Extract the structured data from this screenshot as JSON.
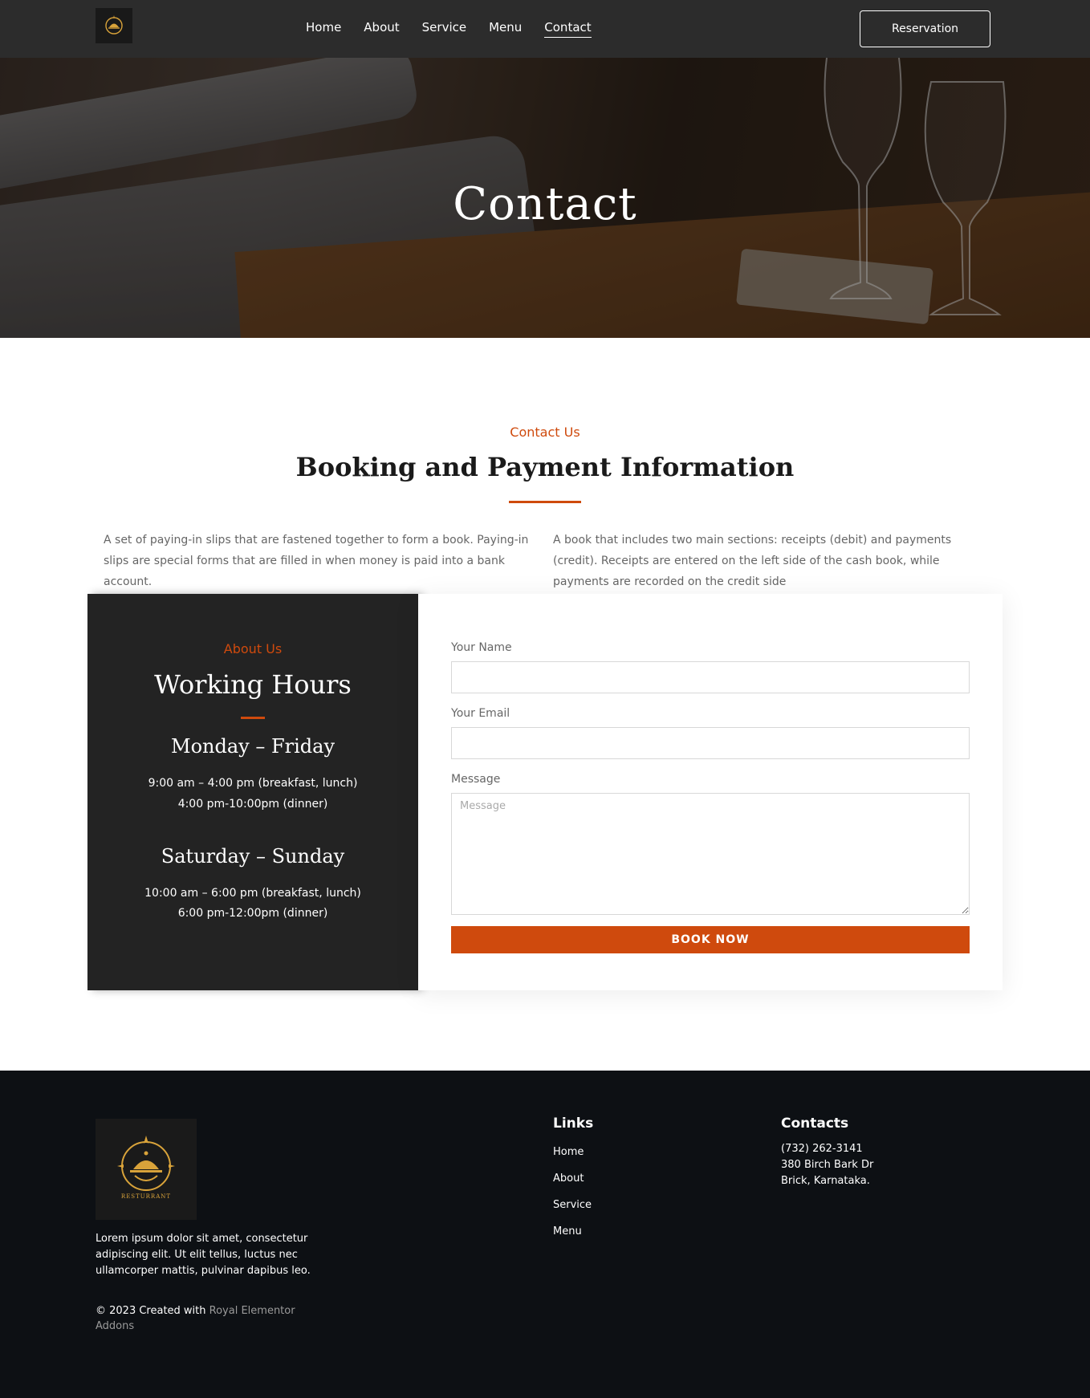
{
  "header": {
    "nav": [
      "Home",
      "About",
      "Service",
      "Menu",
      "Contact"
    ],
    "active_nav": "Contact",
    "reservation_label": "Reservation"
  },
  "hero": {
    "title": "Contact"
  },
  "booking": {
    "eyebrow": "Contact Us",
    "title": "Booking and Payment Information",
    "left_text": "A set of paying-in slips that are fastened together to form a book. Paying-in slips are special forms that are filled in when money is paid into a bank account.",
    "right_text": "A book that includes two main sections: receipts (debit) and payments (credit). Receipts are entered on the left side of the cash book, while payments are recorded on the credit side"
  },
  "hours": {
    "eyebrow": "About Us",
    "title": "Working Hours",
    "weekday_label": "Monday – Friday",
    "weekday_time_1": "9:00 am – 4:00 pm (breakfast, lunch)",
    "weekday_time_2": "4:00 pm-10:00pm (dinner)",
    "weekend_label": "Saturday – Sunday",
    "weekend_time_1": "10:00 am – 6:00 pm (breakfast, lunch)",
    "weekend_time_2": "6:00 pm-12:00pm (dinner)"
  },
  "form": {
    "name_label": "Your Name",
    "name_value": "",
    "email_label": "Your Email",
    "email_value": "",
    "message_label": "Message",
    "message_placeholder": "Message",
    "submit_label": "BOOK NOW"
  },
  "footer": {
    "about_text": "Lorem ipsum dolor sit amet, consectetur adipiscing elit. Ut elit tellus, luctus nec ullamcorper mattis, pulvinar dapibus leo.",
    "copyright_prefix": "© 2023 Created with ",
    "copyright_link": "Royal Elementor Addons",
    "links_heading": "Links",
    "links": [
      "Home",
      "About",
      "Service",
      "Menu"
    ],
    "contacts_heading": "Contacts",
    "phone": "(732) 262-3141",
    "address_1": "380 Birch Bark Dr",
    "address_2": "Brick, Karnataka.",
    "logo_text": "RESTURRANT"
  },
  "colors": {
    "accent": "#cf4a0d",
    "header_bg": "#2c2c2c",
    "hours_bg": "#232323",
    "footer_bg": "#0d1014",
    "logo_gold": "#d9a33a"
  },
  "icons": [
    "restaurant-logo-icon",
    "cloche-icon"
  ]
}
